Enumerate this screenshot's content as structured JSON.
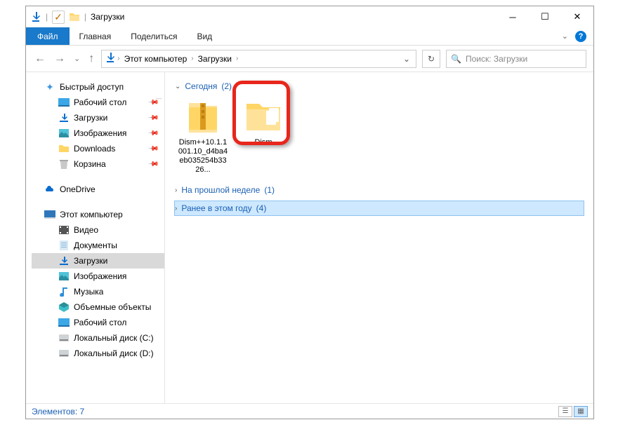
{
  "window": {
    "title": "Загрузки"
  },
  "ribbon": {
    "file": "Файл",
    "tabs": [
      "Главная",
      "Поделиться",
      "Вид"
    ]
  },
  "nav": {
    "crumbs": [
      "Этот компьютер",
      "Загрузки"
    ],
    "search_placeholder": "Поиск: Загрузки"
  },
  "sidebar": {
    "quick": {
      "label": "Быстрый доступ",
      "items": [
        {
          "label": "Рабочий стол",
          "icon": "desktop",
          "pinned": true
        },
        {
          "label": "Загрузки",
          "icon": "download",
          "pinned": true
        },
        {
          "label": "Изображения",
          "icon": "pictures",
          "pinned": true
        },
        {
          "label": "Downloads",
          "icon": "folder",
          "pinned": true
        },
        {
          "label": "Корзина",
          "icon": "trash",
          "pinned": true
        }
      ]
    },
    "onedrive": {
      "label": "OneDrive"
    },
    "thispc": {
      "label": "Этот компьютер",
      "items": [
        {
          "label": "Видео",
          "icon": "video"
        },
        {
          "label": "Документы",
          "icon": "docs"
        },
        {
          "label": "Загрузки",
          "icon": "download",
          "selected": true
        },
        {
          "label": "Изображения",
          "icon": "pictures"
        },
        {
          "label": "Музыка",
          "icon": "music"
        },
        {
          "label": "Объемные объекты",
          "icon": "3d"
        },
        {
          "label": "Рабочий стол",
          "icon": "desktop"
        },
        {
          "label": "Локальный диск (C:)",
          "icon": "disk"
        },
        {
          "label": "Локальный диск (D:)",
          "icon": "disk"
        }
      ]
    }
  },
  "groups": [
    {
      "label": "Сегодня",
      "count": "(2)",
      "expanded": true,
      "items": [
        {
          "label": "Dism++10.1.1001.10_d4ba4eb035254b3326...",
          "type": "zip"
        },
        {
          "label": "Dism",
          "type": "folder",
          "highlighted": true
        }
      ]
    },
    {
      "label": "На прошлой неделе",
      "count": "(1)",
      "expanded": false
    },
    {
      "label": "Ранее в этом году",
      "count": "(4)",
      "expanded": false,
      "selected": true
    }
  ],
  "status": {
    "items": "Элементов: 7"
  }
}
